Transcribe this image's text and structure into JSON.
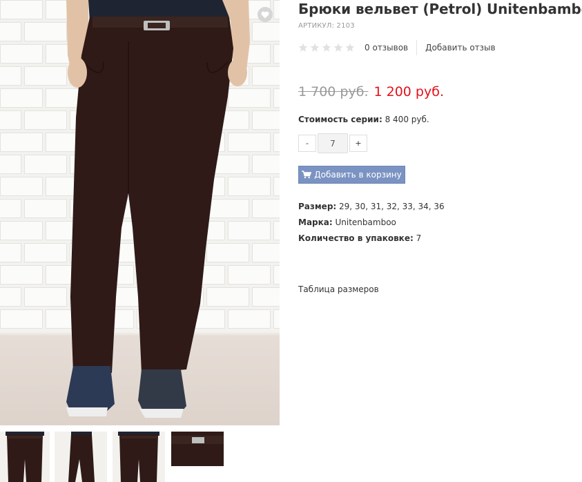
{
  "product": {
    "title": "Брюки вельвет (Petrol) Unitenbamboo",
    "sku_label": "Артикул:",
    "sku_value": "2103"
  },
  "rating": {
    "stars_filled": 0,
    "stars_total": 5,
    "reviews_count": "0 отзывов",
    "add_review": "Добавить отзыв"
  },
  "price": {
    "old": "1 700 руб.",
    "new": "1 200 руб."
  },
  "series": {
    "label": "Стоимость серии:",
    "value": "8 400 руб."
  },
  "quantity": {
    "minus": "-",
    "value": "7",
    "plus": "+"
  },
  "cart": {
    "button_label": "Добавить в корзину",
    "icon": "shopping-cart-icon"
  },
  "properties": [
    {
      "label": "Размер:",
      "value": "29, 30, 31, 32, 33, 34, 36"
    },
    {
      "label": "Марка:",
      "value": "Unitenbamboo"
    },
    {
      "label": "Количество в упаковке:",
      "value": "7"
    }
  ],
  "size_table_link": "Таблица размеров",
  "favorite_icon": "heart-icon",
  "colors": {
    "price_new": "#e3111b",
    "price_old": "#999999",
    "cart_button": "#7b93c2",
    "pants": "#2f1a17"
  }
}
